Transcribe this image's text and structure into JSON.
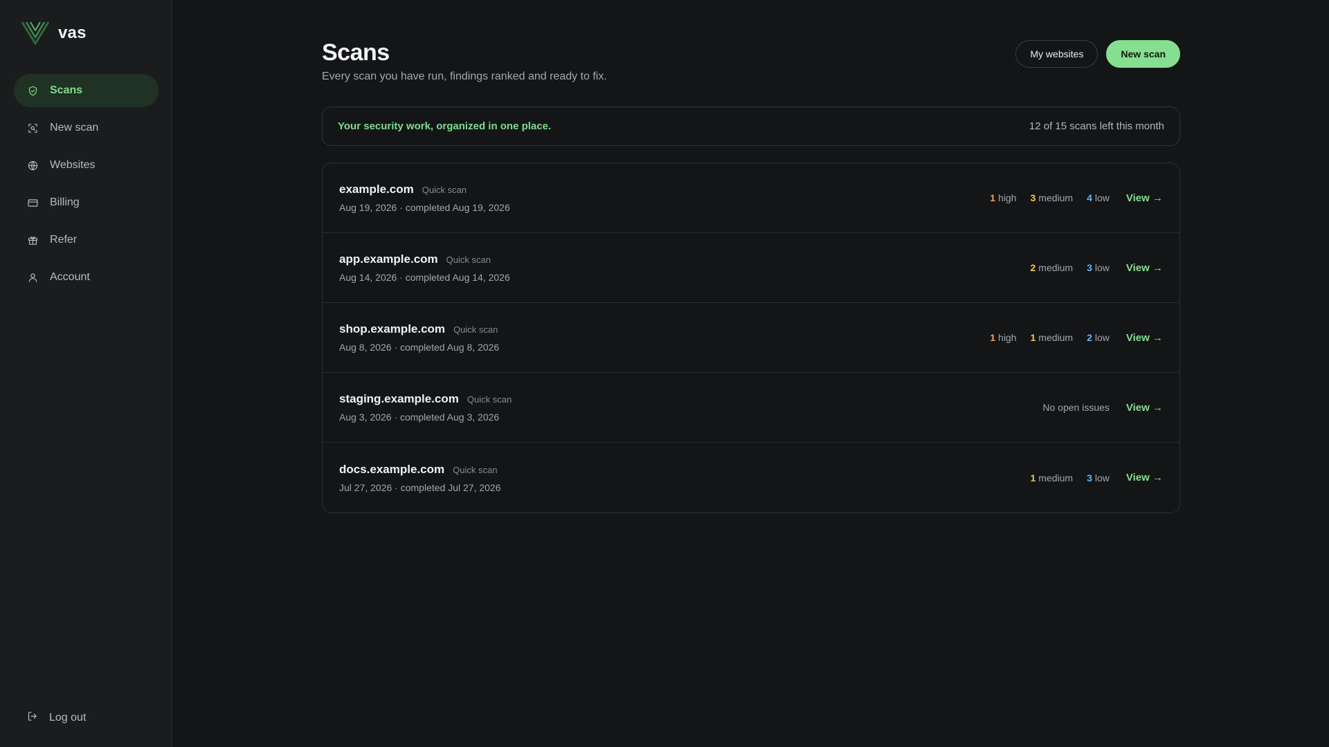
{
  "brand": {
    "name": "vas"
  },
  "colors": {
    "accent": "#86de91",
    "high": "#f0a35a",
    "medium": "#f2c94c",
    "low": "#63b6f2"
  },
  "sidebar": {
    "items": [
      {
        "label": "Scans",
        "icon": "shield-icon",
        "active": true
      },
      {
        "label": "New scan",
        "icon": "scan-icon",
        "active": false
      },
      {
        "label": "Websites",
        "icon": "globe-icon",
        "active": false
      },
      {
        "label": "Billing",
        "icon": "credit-card-icon",
        "active": false
      },
      {
        "label": "Refer",
        "icon": "gift-icon",
        "active": false
      },
      {
        "label": "Account",
        "icon": "user-icon",
        "active": false
      }
    ],
    "logout_label": "Log out"
  },
  "header": {
    "title": "Scans",
    "subtitle": "Every scan you have run, findings ranked and ready to fix.",
    "my_websites_label": "My websites",
    "new_scan_label": "New scan"
  },
  "banner": {
    "message": "Your security work, organized in one place.",
    "quota": "12 of 15 scans left this month"
  },
  "scans": [
    {
      "domain": "example.com",
      "type": "Quick scan",
      "dates": "Aug 19, 2026 · completed Aug 19, 2026",
      "findings": [
        {
          "count": "1",
          "label": "high"
        },
        {
          "count": "3",
          "label": "medium"
        },
        {
          "count": "4",
          "label": "low"
        }
      ],
      "view_label": "View →"
    },
    {
      "domain": "app.example.com",
      "type": "Quick scan",
      "dates": "Aug 14, 2026 · completed Aug 14, 2026",
      "findings": [
        {
          "count": "2",
          "label": "medium"
        },
        {
          "count": "3",
          "label": "low"
        }
      ],
      "view_label": "View →"
    },
    {
      "domain": "shop.example.com",
      "type": "Quick scan",
      "dates": "Aug 8, 2026 · completed Aug 8, 2026",
      "findings": [
        {
          "count": "1",
          "label": "high"
        },
        {
          "count": "1",
          "label": "medium"
        },
        {
          "count": "2",
          "label": "low"
        }
      ],
      "view_label": "View →"
    },
    {
      "domain": "staging.example.com",
      "type": "Quick scan",
      "dates": "Aug 3, 2026 · completed Aug 3, 2026",
      "findings": [],
      "no_issues": "No open issues",
      "view_label": "View →"
    },
    {
      "domain": "docs.example.com",
      "type": "Quick scan",
      "dates": "Jul 27, 2026 · completed Jul 27, 2026",
      "findings": [
        {
          "count": "1",
          "label": "medium"
        },
        {
          "count": "3",
          "label": "low"
        }
      ],
      "view_label": "View →"
    }
  ]
}
